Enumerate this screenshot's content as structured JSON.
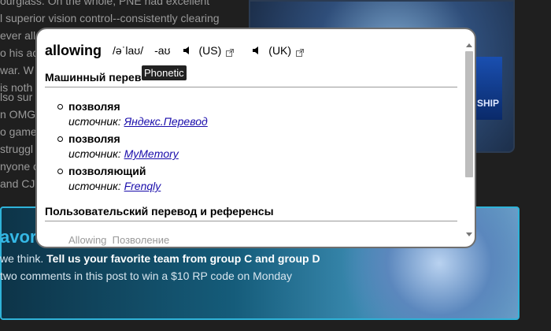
{
  "background": {
    "paragraph1": [
      "ourglass. On the whole, PNE had excellent",
      "l superior vision control--consistently clearing",
      "ever allowing them a chance to breathe. uRoko",
      "o his ac",
      "war. W",
      "is noth"
    ],
    "paragraph2": [
      "lso sur",
      "n OMG",
      "o game",
      "struggl",
      "nyone c",
      "and CJ"
    ],
    "art_badge": "SHIP",
    "banner_title": "avor",
    "banner_line1_prefix": "we think. ",
    "banner_line1_bold": "Tell us your favorite team from group C and group D",
    "banner_line2": "two comments in this post to win a $10 RP code on Monday"
  },
  "popup": {
    "word": "allowing",
    "phonetic_full": "/əˈlaʊ/",
    "phonetic_short": "-aʊ",
    "locales": [
      {
        "label": "(US)"
      },
      {
        "label": "(UK)"
      }
    ],
    "tooltip": "Phonetic",
    "machine_section_title": "Машинный перев",
    "translations": [
      {
        "text": "позволяя",
        "source_label": "источник:",
        "source": "Яндекс.Перевод"
      },
      {
        "text": "позволяя",
        "source_label": "источник:",
        "source": "MyMemory"
      },
      {
        "text": "позволяющий",
        "source_label": "источник:",
        "source": "Frenqly"
      }
    ],
    "user_section_title": "Пользовательский перевод и референсы",
    "cut_text": "Allowing  Позволение"
  },
  "colors": {
    "link": "#1a0dab",
    "banner_border": "#2fb3d9",
    "banner_title": "#35b8e6"
  }
}
